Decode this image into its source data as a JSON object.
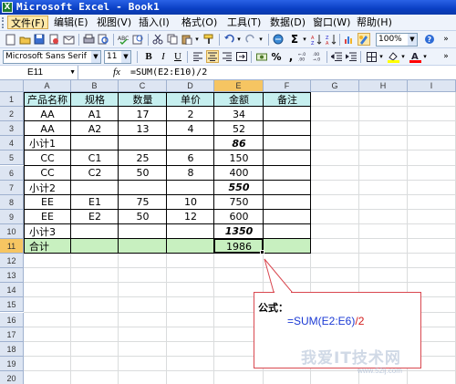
{
  "window": {
    "title": "Microsoft Excel - Book1",
    "app_icon_glyph": "X",
    "titlebar_color": "#0a3fc4"
  },
  "menu": {
    "items": [
      "文件(F)",
      "编辑(E)",
      "视图(V)",
      "插入(I)",
      "格式(O)",
      "工具(T)",
      "数据(D)",
      "窗口(W)",
      "帮助(H)"
    ],
    "active_index": 0
  },
  "toolbar": {
    "zoom": "100%",
    "sigma_glyph": "Σ",
    "icons": [
      "new-icon",
      "open-icon",
      "save-icon",
      "permission-icon",
      "email-icon",
      "print-icon",
      "print-preview-icon",
      "spelling-icon",
      "research-icon",
      "cut-icon",
      "copy-icon",
      "paste-icon",
      "format-painter-icon",
      "undo-icon",
      "redo-icon",
      "hyperlink-icon",
      "autosum-icon",
      "sort-ascending-icon",
      "sort-descending-icon",
      "chart-wizard-icon",
      "drawing-icon",
      "zoom-icon",
      "help-icon"
    ]
  },
  "format_toolbar": {
    "font": "Microsoft Sans Serif",
    "size": "11",
    "bold": "B",
    "italic": "I",
    "underline": "U",
    "percent": "%",
    "comma": ",",
    "fill_color": "#ffff00",
    "font_color": "#ff0000"
  },
  "formula_bar": {
    "name_box": "E11",
    "fx": "fx",
    "formula": "=SUM(E2:E10)/2"
  },
  "sheet": {
    "columns": [
      "A",
      "B",
      "C",
      "D",
      "E",
      "F",
      "G",
      "H",
      "I"
    ],
    "active_column": "E",
    "rows": [
      "1",
      "2",
      "3",
      "4",
      "5",
      "6",
      "7",
      "8",
      "9",
      "10",
      "11",
      "12",
      "13",
      "14",
      "15",
      "16",
      "17",
      "18",
      "19",
      "20"
    ],
    "active_row": "11",
    "header_color": "#c6efef",
    "total_color": "#c8f0c0",
    "cells": {
      "header": [
        "产品名称",
        "规格",
        "数量",
        "单价",
        "金额",
        "备注"
      ],
      "r2": [
        "AA",
        "A1",
        "17",
        "2",
        "34",
        ""
      ],
      "r3": [
        "AA",
        "A2",
        "13",
        "4",
        "52",
        ""
      ],
      "r4": [
        "小计1",
        "",
        "",
        "",
        "86",
        ""
      ],
      "r5": [
        "CC",
        "C1",
        "25",
        "6",
        "150",
        ""
      ],
      "r6": [
        "CC",
        "C2",
        "50",
        "8",
        "400",
        ""
      ],
      "r7": [
        "小计2",
        "",
        "",
        "",
        "550",
        ""
      ],
      "r8": [
        "EE",
        "E1",
        "75",
        "10",
        "750",
        ""
      ],
      "r9": [
        "EE",
        "E2",
        "50",
        "12",
        "600",
        ""
      ],
      "r10": [
        "小计3",
        "",
        "",
        "",
        "1350",
        ""
      ],
      "r11": [
        "合计",
        "",
        "",
        "",
        "1986",
        ""
      ]
    }
  },
  "callout": {
    "label": "公式：",
    "formula_main": "=SUM(E2:E6)",
    "formula_suffix": "/2"
  },
  "watermark": {
    "text": "我爱IT技术网",
    "url": "www.52ij.com"
  }
}
